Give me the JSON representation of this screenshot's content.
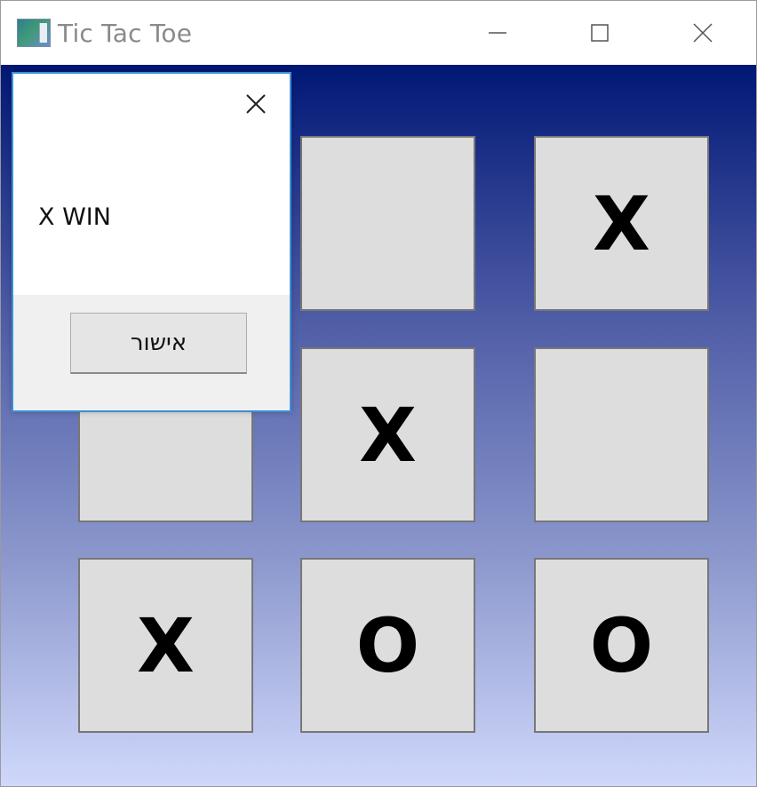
{
  "window": {
    "title": "Tic Tac Toe"
  },
  "board": {
    "cells": [
      "",
      "",
      "X",
      "",
      "X",
      "",
      "X",
      "O",
      "O"
    ]
  },
  "dialog": {
    "message": "X WIN",
    "ok_label": "אישור"
  },
  "colors": {
    "gradient_top": "#001775",
    "gradient_bottom": "#cfd8fb",
    "cell_bg": "#dddddd",
    "dialog_border": "#3b8fd6"
  }
}
